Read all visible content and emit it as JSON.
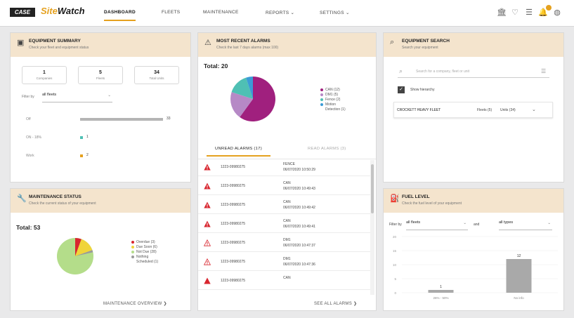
{
  "brand": {
    "case_label": "CASE",
    "site_label": "Site",
    "watch_label": "Watch"
  },
  "nav": [
    {
      "label": "DASHBOARD"
    },
    {
      "label": "FLEETS"
    },
    {
      "label": "MAINTENANCE"
    },
    {
      "label": "REPORTS ⌄"
    },
    {
      "label": "SETTINGS ⌄"
    }
  ],
  "equipment_summary": {
    "title": "EQUIPMENT SUMMARY",
    "subtitle": "Check your fleet and equipment status",
    "stats": [
      {
        "value": "1",
        "label": "Companies"
      },
      {
        "value": "5",
        "label": "Fleets"
      },
      {
        "value": "34",
        "label": "Total Units"
      }
    ],
    "filter_label": "Filter by",
    "filter_value": "all fleets",
    "rows": [
      {
        "label": "Off",
        "value": "33"
      },
      {
        "label": "ON - 18%",
        "value": "1"
      },
      {
        "label": "Work",
        "value": "2"
      }
    ]
  },
  "alarms": {
    "title": "MOST RECENT ALARMS",
    "subtitle": "Check the last 7 days alarms (max 100)",
    "total": "Total: 20",
    "legend": [
      {
        "label": "CAN (12)",
        "color": "#a0207e"
      },
      {
        "label": "DM1 (5)",
        "color": "#b689c6"
      },
      {
        "label": "Fence (2)",
        "color": "#4fc0b4"
      },
      {
        "label": "Motion",
        "color": "#3b9bd6"
      },
      {
        "label": "Detection (1)",
        "color": ""
      }
    ],
    "tab_unread": "UNREAD ALARMS (17)",
    "tab_read": "READ ALARMS (3)",
    "rows": [
      {
        "unit": "1223-09980275",
        "type": "FENCE",
        "time": "06/07/2020 10:50:29",
        "severity": "high"
      },
      {
        "unit": "1223-09980275",
        "type": "CAN",
        "time": "06/07/2020 10:49:43",
        "severity": "high"
      },
      {
        "unit": "1223-09980275",
        "type": "CAN",
        "time": "06/07/2020 10:49:42",
        "severity": "high"
      },
      {
        "unit": "1223-09980275",
        "type": "CAN",
        "time": "06/07/2020 10:49:41",
        "severity": "high"
      },
      {
        "unit": "1223-09980275",
        "type": "DM1",
        "time": "06/07/2020 10:47:37",
        "severity": "low"
      },
      {
        "unit": "1223-09980275",
        "type": "DM1",
        "time": "06/07/2020 10:47:36",
        "severity": "low"
      },
      {
        "unit": "1223-09980275",
        "type": "CAN",
        "time": "",
        "severity": "high"
      }
    ],
    "see_all": "SEE ALL ALARMS ❯"
  },
  "equipment_search": {
    "title": "EQUIPMENT SEARCH",
    "subtitle": "Search your equipment",
    "placeholder": "Search for a company, fleet or unit",
    "hierarchy_label": "Show hierarchy",
    "fleet_name": "CROCKETT HEAVY FLEET",
    "fleets_count": "Fleets (5)",
    "units_count": "Units (34)"
  },
  "maintenance": {
    "title": "MAINTENANCE STATUS",
    "subtitle": "Check the current status of your equipment",
    "total": "Total: 53",
    "legend": [
      {
        "label": "Overdue (3)",
        "color": "#d8262f"
      },
      {
        "label": "Due Soon (6)",
        "color": "#f0d43a"
      },
      {
        "label": "Not Due (28)",
        "color": "#b4dd8a"
      },
      {
        "label": "Nothing",
        "color": "#9a9a9a"
      },
      {
        "label": "Scheduled (1)",
        "color": ""
      }
    ],
    "link": "MAINTENANCE OVERVIEW ❯"
  },
  "fuel": {
    "title": "FUEL LEVEL",
    "subtitle": "Check the fuel level of your equipment",
    "filter_label": "Filter by",
    "fleet_filter": "all fleets",
    "and_label": "and",
    "type_filter": "all types"
  },
  "chart_data": {
    "type": "bar",
    "categories": [
      "26% - 50%",
      "No info"
    ],
    "values": [
      1,
      12
    ],
    "data_labels": [
      "1",
      "12"
    ],
    "yticks": [
      "20",
      "15",
      "10",
      "5",
      "0"
    ],
    "ylim": [
      0,
      20
    ],
    "bar_color": "#a9a9a9"
  },
  "colors": {
    "accent": "#e5a11f",
    "header_bg": "#f4e4cd",
    "alarm_red": "#d8262f"
  }
}
